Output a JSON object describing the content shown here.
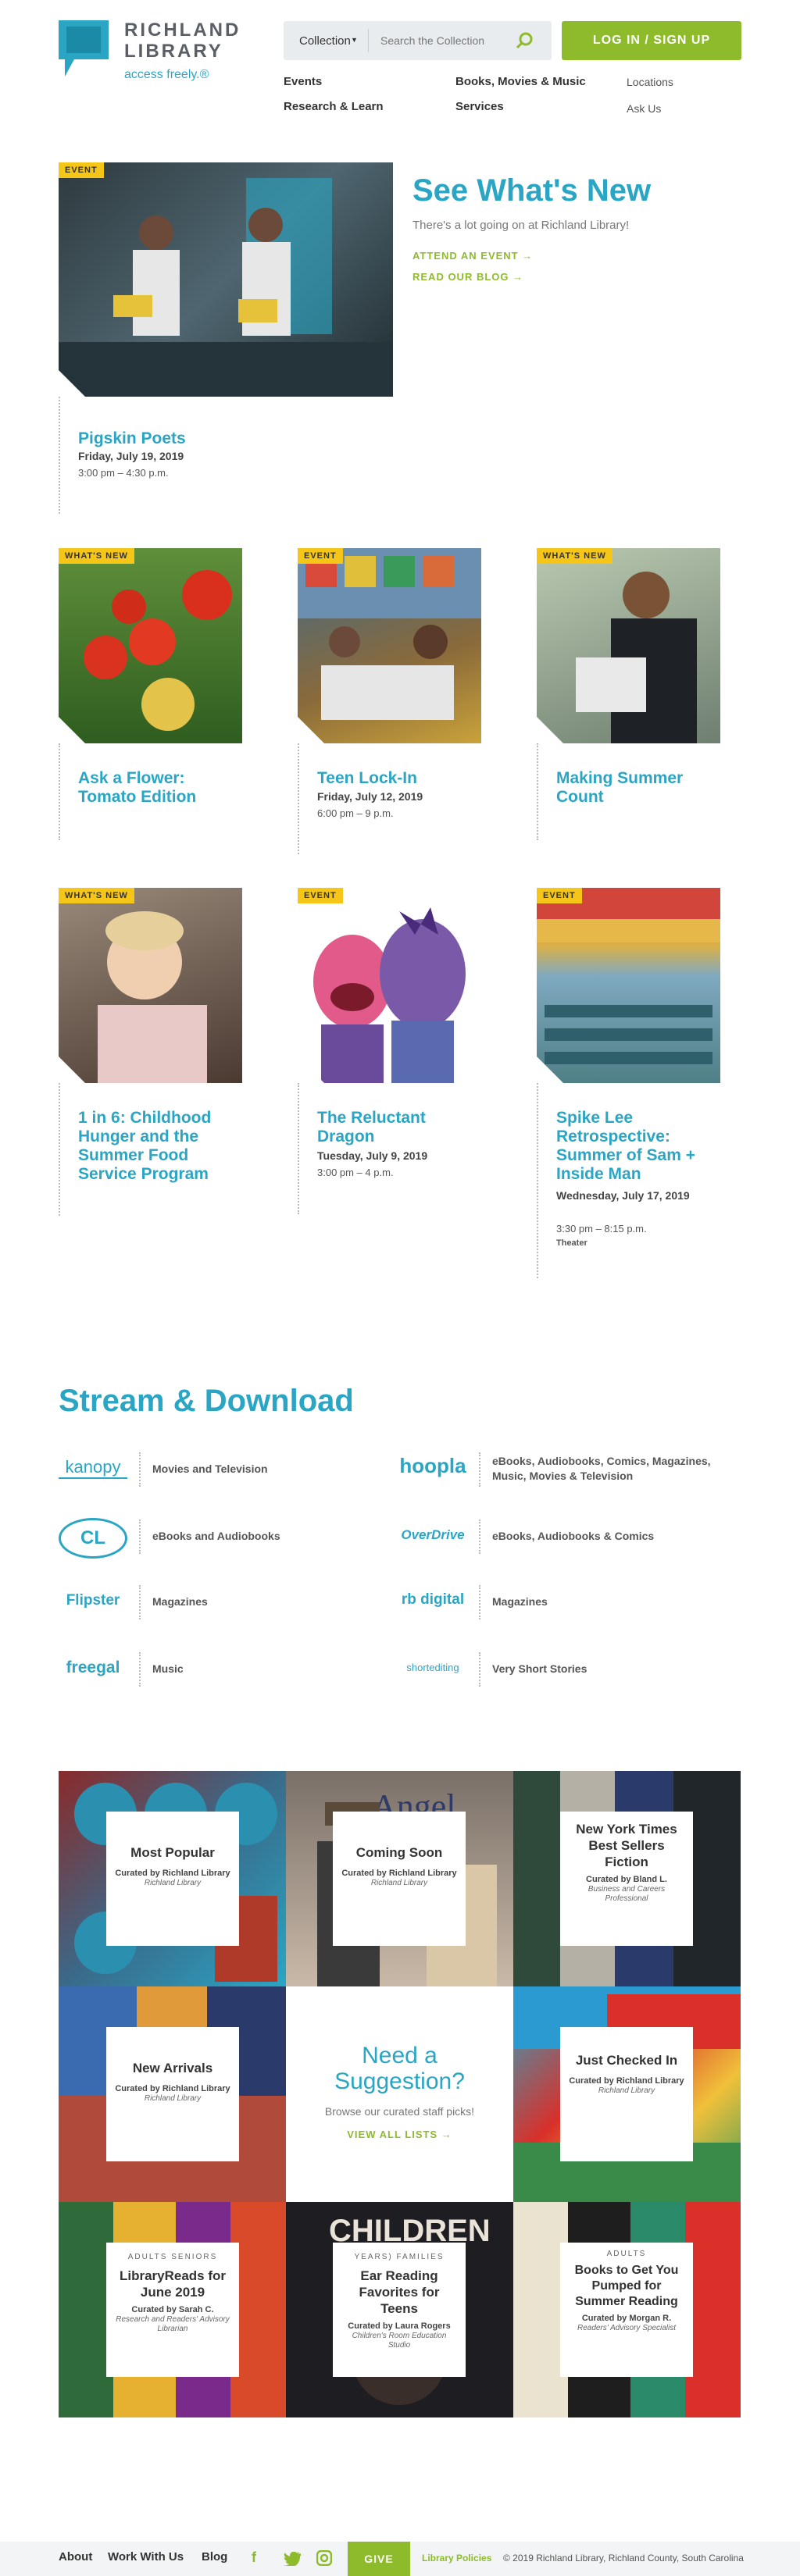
{
  "header": {
    "logo_line1": "RICHLAND",
    "logo_line2": "LIBRARY",
    "tagline": "access freely.®",
    "search_scope": "Collection",
    "search_placeholder": "Search the Collection",
    "login_label": "LOG IN / SIGN UP",
    "nav": [
      "Events",
      "Research & Learn",
      "Books, Movies & Music",
      "Services"
    ],
    "nav_secondary": [
      "Locations",
      "Ask Us"
    ]
  },
  "hero": {
    "badge": "EVENT",
    "heading": "See What's New",
    "subheading": "There's a lot going on at Richland Library!",
    "link_event": "ATTEND AN EVENT →",
    "link_blog": "READ OUR BLOG →",
    "card": {
      "title": "Pigskin Poets",
      "date": "Friday, July 19, 2019",
      "time": "3:00 pm – 4:30 p.m."
    }
  },
  "cards": [
    {
      "badge": "WHAT'S NEW",
      "title": "Ask a Flower: Tomato Edition",
      "date": "",
      "time": "",
      "extra": ""
    },
    {
      "badge": "EVENT",
      "title": "Teen Lock-In",
      "date": "Friday, July 12, 2019",
      "time": "6:00 pm – 9 p.m.",
      "extra": ""
    },
    {
      "badge": "WHAT'S NEW",
      "title": "Making Summer Count",
      "date": "",
      "time": "",
      "extra": ""
    },
    {
      "badge": "WHAT'S NEW",
      "title": "1 in 6: Childhood Hunger and the Summer Food Service Program",
      "date": "",
      "time": "",
      "extra": ""
    },
    {
      "badge": "EVENT",
      "title": "The Reluctant Dragon",
      "date": "Tuesday, July 9, 2019",
      "time": "3:00 pm – 4 p.m.",
      "extra": ""
    },
    {
      "badge": "EVENT",
      "title": "Spike Lee Retrospective: Summer of Sam + Inside Man",
      "date": "Wednesday, July 17, 2019",
      "time": "3:30 pm – 8:15 p.m.",
      "extra": "Theater"
    }
  ],
  "stream": {
    "heading": "Stream & Download",
    "services": [
      {
        "logo": "kanopy",
        "desc": "Movies and Television"
      },
      {
        "logo": "hoopla",
        "desc": "eBooks, Audiobooks, Comics, Magazines, Music, Movies & Television"
      },
      {
        "logo": "CL",
        "desc": "eBooks and Audiobooks"
      },
      {
        "logo": "OverDrive",
        "desc": "eBooks, Audiobooks & Comics"
      },
      {
        "logo": "Flipster",
        "desc": "Magazines"
      },
      {
        "logo": "rb digital",
        "desc": "Magazines"
      },
      {
        "logo": "freegal",
        "desc": "Music"
      },
      {
        "logo": "shortediting",
        "desc": "Very Short Stories"
      }
    ]
  },
  "lists": {
    "suggest_heading": "Need a Suggestion?",
    "suggest_sub": "Browse our curated staff picks!",
    "suggest_link": "VIEW ALL LISTS →",
    "tiles": [
      {
        "kicker": "",
        "title": "Most Popular",
        "curator": "Curated by Richland Library",
        "role": "Richland Library"
      },
      {
        "kicker": "",
        "title": "Coming Soon",
        "curator": "Curated by Richland Library",
        "role": "Richland Library"
      },
      {
        "kicker": "",
        "title": "New York Times Best Sellers Fiction",
        "curator": "Curated by Bland L.",
        "role": "Business and Careers Professional"
      },
      {
        "kicker": "",
        "title": "New Arrivals",
        "curator": "Curated by Richland Library",
        "role": "Richland Library"
      },
      {
        "kicker": "",
        "title": "Just Checked In",
        "curator": "Curated by Richland Library",
        "role": "Richland Library"
      },
      {
        "kicker": "ADULTS SENIORS",
        "title": "LibraryReads for June 2019",
        "curator": "Curated by Sarah C.",
        "role": "Research and Readers' Advisory Librarian"
      },
      {
        "kicker": "YEARS) FAMILIES",
        "title": "Ear Reading Favorites for Teens",
        "curator": "Curated by Laura Rogers",
        "role": "Children's Room Education Studio"
      },
      {
        "kicker": "ADULTS",
        "title": "Books to Get You Pumped for Summer Reading",
        "curator": "Curated by Morgan R.",
        "role": "Readers' Advisory Specialist"
      }
    ]
  },
  "footer": {
    "links": [
      "About",
      "Work With Us",
      "Blog"
    ],
    "give": "GIVE",
    "policies": "Library Policies",
    "copyright": "© 2019 Richland Library, Richland County, South Carolina"
  },
  "colors": {
    "accent": "#2aa6c4",
    "green": "#8dbb2c",
    "badge": "#f5c518"
  }
}
